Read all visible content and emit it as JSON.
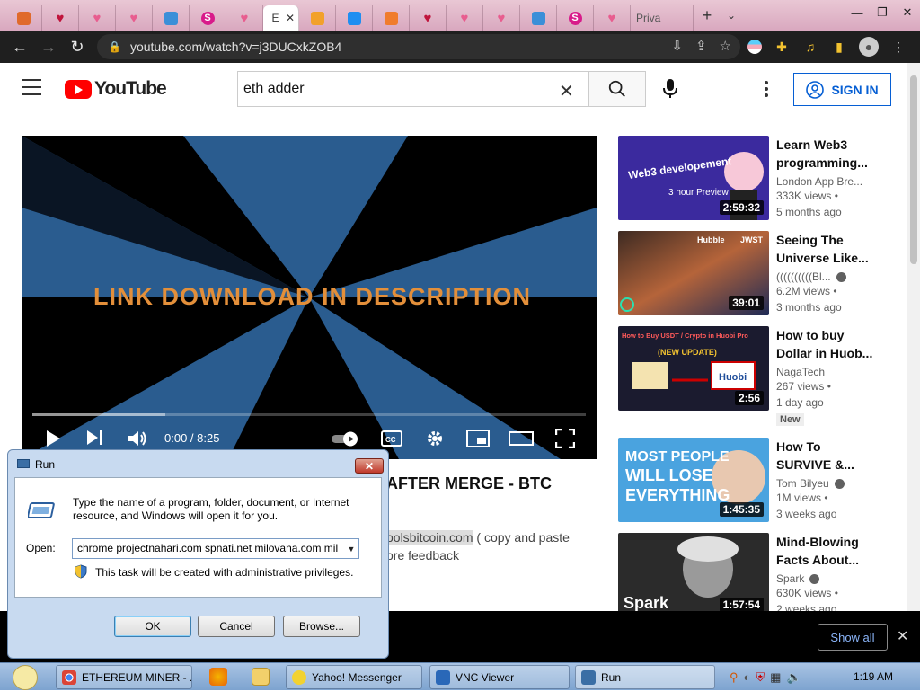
{
  "browser": {
    "tabs": [
      {
        "icon": "github-icon",
        "color": "#e06a2b"
      },
      {
        "icon": "heart-icon",
        "color": "#c0143c"
      },
      {
        "icon": "heart-icon",
        "color": "#e85d8f"
      },
      {
        "icon": "heart-icon",
        "color": "#e85d8f"
      },
      {
        "icon": "globe-icon",
        "color": "#3b8fd8"
      },
      {
        "icon": "s-icon",
        "color": "#d81b8a",
        "letter": "S"
      },
      {
        "icon": "heart-icon",
        "color": "#e85d8f"
      }
    ],
    "active_tab_label": "E",
    "tabs_after": [
      {
        "icon": "bitcoin-icon",
        "color": "#f2a12b"
      },
      {
        "icon": "chat-icon",
        "color": "#1f8ef1"
      },
      {
        "icon": "tools-icon",
        "color": "#f07c2c"
      },
      {
        "icon": "heart-icon",
        "color": "#c0143c"
      },
      {
        "icon": "heart-icon",
        "color": "#e85d8f"
      },
      {
        "icon": "heart-icon",
        "color": "#e85d8f"
      },
      {
        "icon": "globe-icon",
        "color": "#3b8fd8"
      },
      {
        "icon": "s-icon",
        "color": "#d81b8a",
        "letter": "S"
      },
      {
        "icon": "heart-icon",
        "color": "#e85d8f"
      }
    ],
    "private_tab": "Priva",
    "url": "youtube.com/watch?v=j3DUCxkZOB4"
  },
  "youtube": {
    "logo_text": "YouTube",
    "search_value": "eth adder",
    "signin_label": "SIGN IN",
    "video": {
      "overlay_text": "LINK DOWNLOAD IN DESCRIPTION",
      "timecode": "0:00 / 8:25",
      "progress_fraction": 0.24,
      "title": "AFTER MERGE - BTC",
      "desc_line1_link": "oolsbitcoin.com",
      "desc_line1_rest": " ( copy and paste",
      "desc_line2": "ore feedback"
    },
    "recommendations": [
      {
        "title": "Learn Web3 programming...",
        "channel": "London App Bre...",
        "views": "333K views •",
        "age": "5 months ago",
        "duration": "2:59:32",
        "verified": false,
        "badge": ""
      },
      {
        "title": "Seeing The Universe Like...",
        "channel": "((((((((((Bl...",
        "views": "6.2M views •",
        "age": "3 months ago",
        "duration": "39:01",
        "verified": true,
        "badge": ""
      },
      {
        "title": "How to buy Dollar in Huob...",
        "channel": "NagaTech",
        "views": "267 views •",
        "age": "1 day ago",
        "duration": "2:56",
        "verified": false,
        "badge": "New"
      },
      {
        "title": "How To SURVIVE &...",
        "channel": "Tom Bilyeu",
        "views": "1M views •",
        "age": "3 weeks ago",
        "duration": "1:45:35",
        "verified": true,
        "badge": ""
      },
      {
        "title": "Mind-Blowing Facts About...",
        "channel": "Spark",
        "views": "630K views •",
        "age": "2 weeks ago",
        "duration": "1:57:54",
        "verified": true,
        "badge": ""
      }
    ],
    "thumb_texts": {
      "t1_main": "Web3 developement",
      "t1_sub": "3 hour Preview",
      "t2_a": "Hubble",
      "t2_b": "JWST",
      "t3_top": "How to Buy USDT / Crypto in Huobi Pro",
      "t3_mid": "(NEW UPDATE)",
      "t3_logo": "Huobi",
      "t4_text": "MOST PEOPLE WILL LOSE EVERYTHING",
      "t5_text": "Spark"
    }
  },
  "shelf": {
    "show_all": "Show all"
  },
  "run_dialog": {
    "title": "Run",
    "message": "Type the name of a program, folder, document, or Internet resource, and Windows will open it for you.",
    "open_label": "Open:",
    "open_value": "chrome projectnahari.com spnati.net milovana.com mil",
    "admin_note": "This task will be created with administrative privileges.",
    "ok": "OK",
    "cancel": "Cancel",
    "browse": "Browse..."
  },
  "taskbar": {
    "items": [
      {
        "label": "ETHEREUM MINER - ...",
        "icon": "chrome-icon"
      },
      {
        "label": "Yahoo! Messenger",
        "icon": "yahoo-icon"
      },
      {
        "label": "VNC Viewer",
        "icon": "vnc-icon"
      },
      {
        "label": "Run",
        "icon": "run-icon"
      }
    ],
    "clock": "1:19 AM"
  }
}
